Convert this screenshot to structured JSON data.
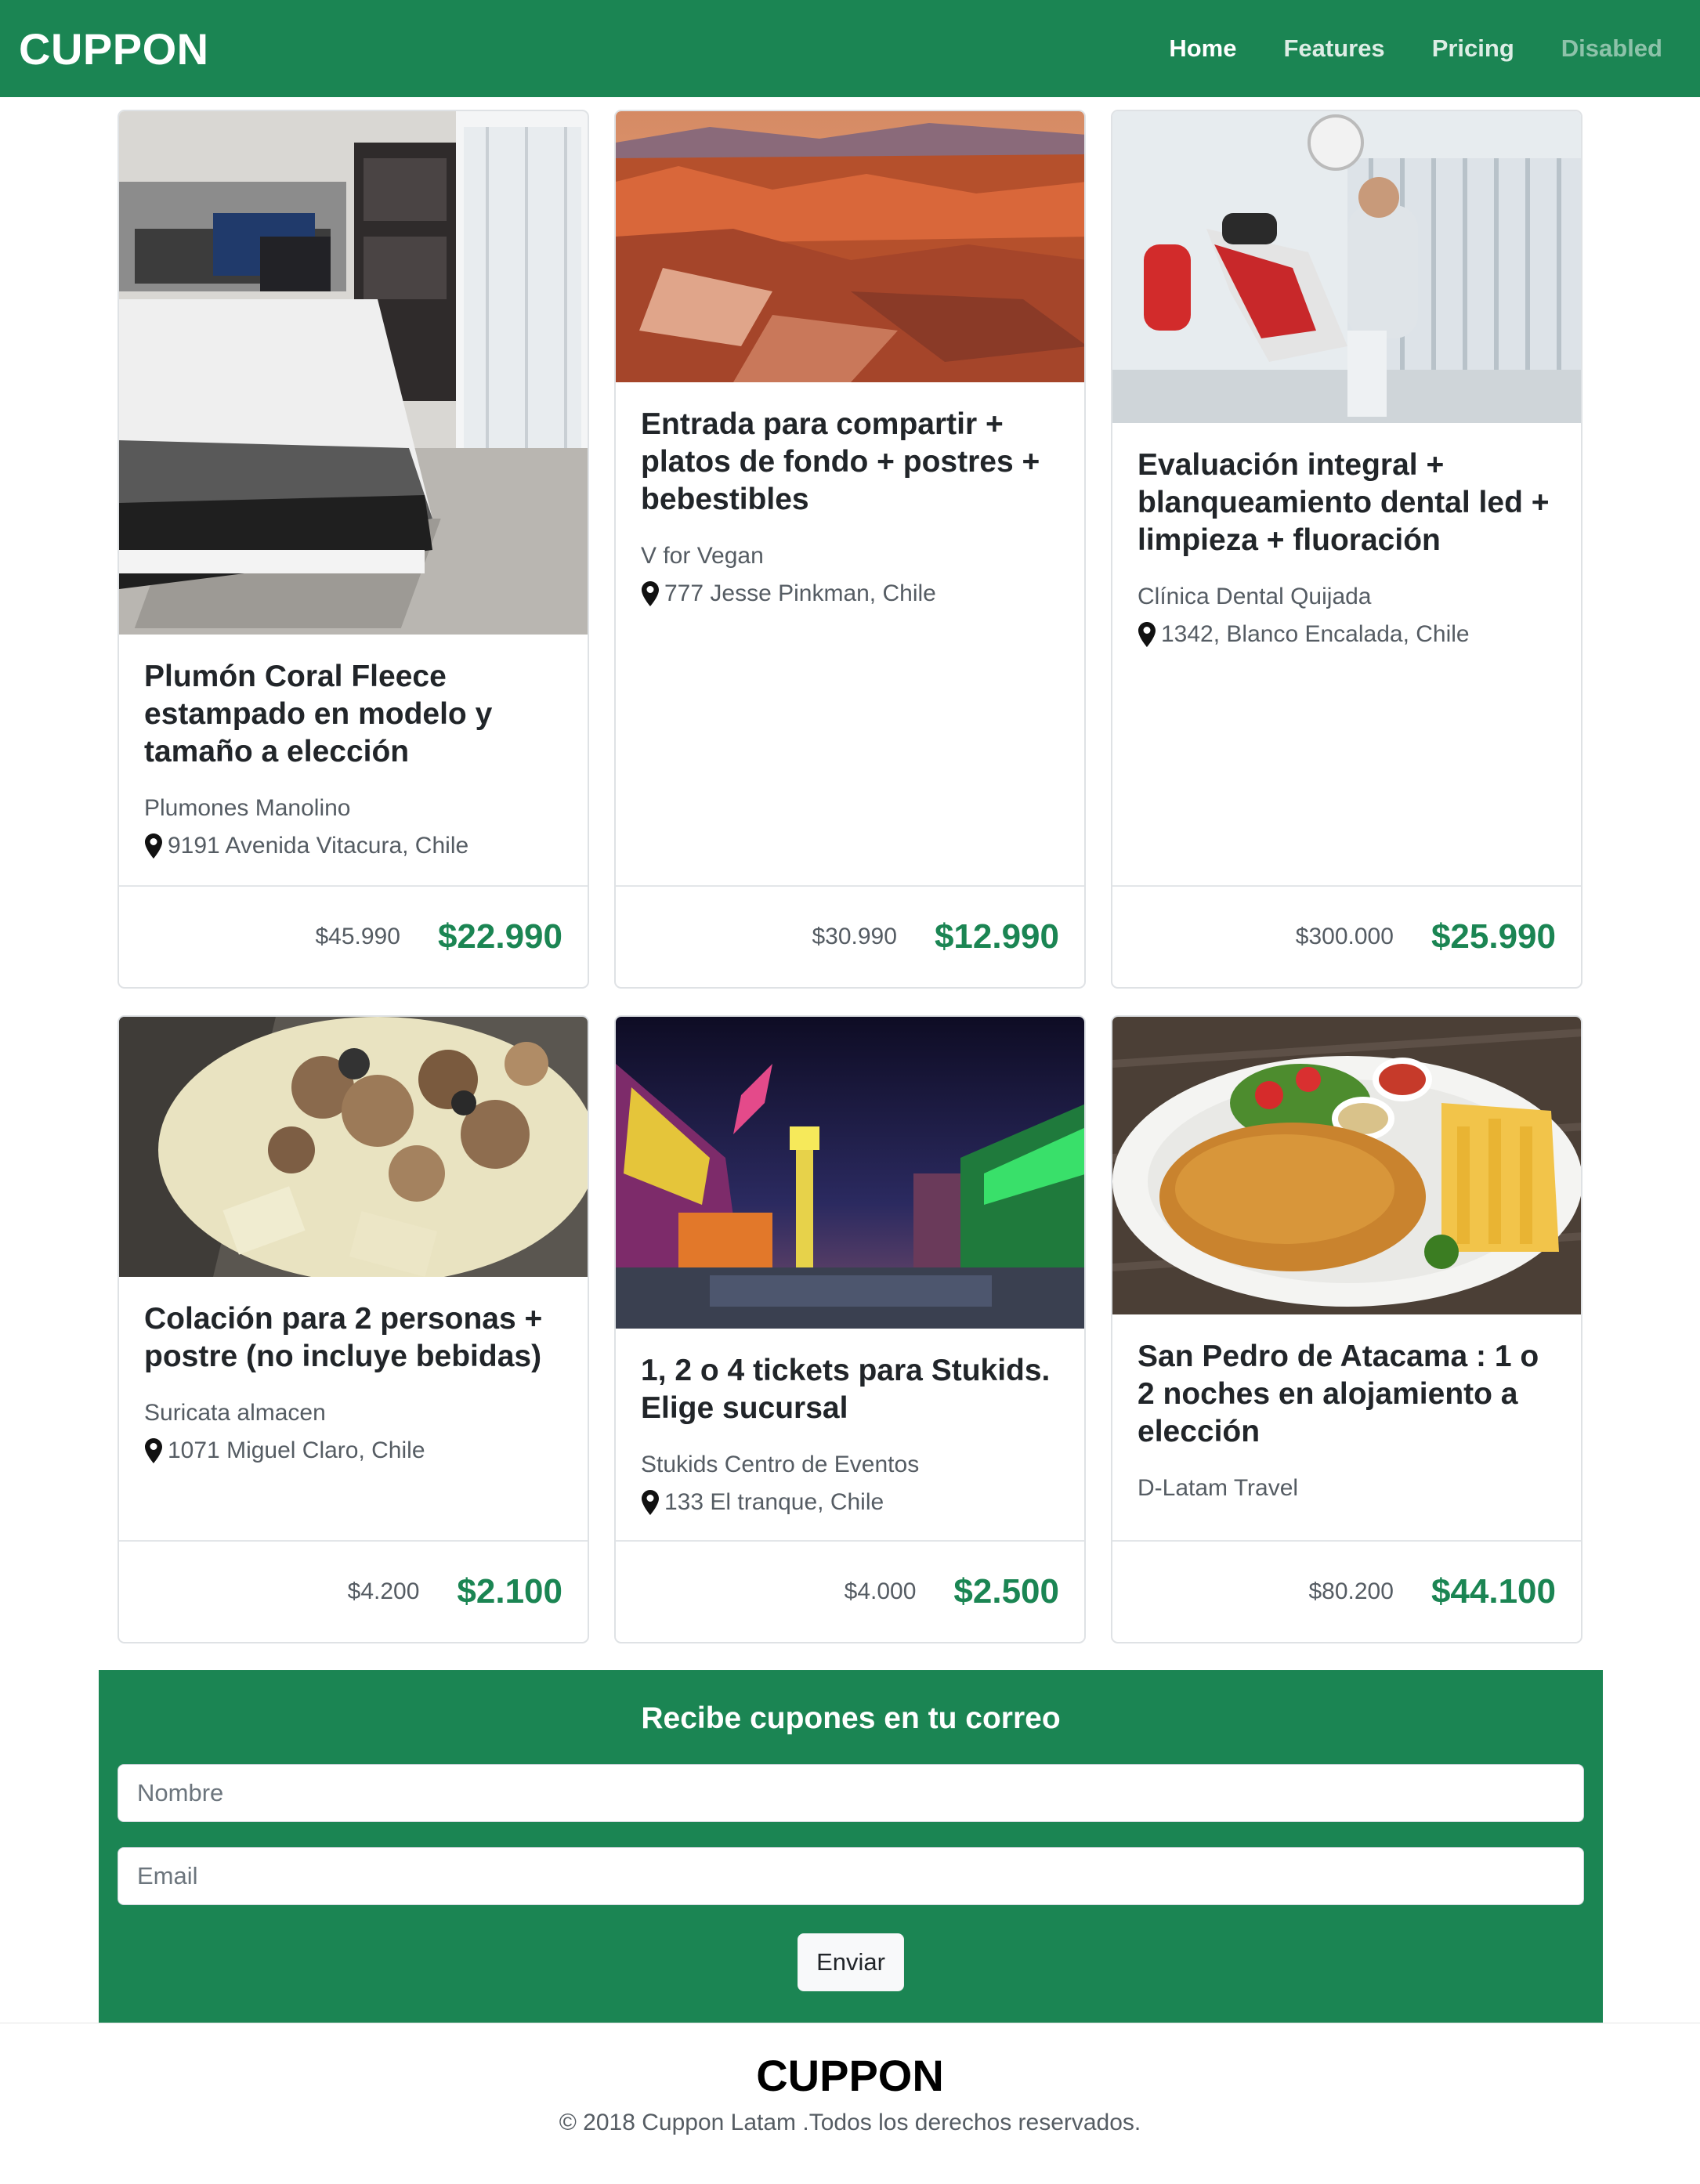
{
  "navbar": {
    "brand": "CUPPON",
    "links": [
      {
        "label": "Home",
        "state": "active"
      },
      {
        "label": "Features",
        "state": "normal"
      },
      {
        "label": "Pricing",
        "state": "normal"
      },
      {
        "label": "Disabled",
        "state": "disabled"
      }
    ]
  },
  "colors": {
    "brand_green": "#1b8553",
    "card_border": "#dfe2e5"
  },
  "deals": [
    {
      "title": "Plumón Coral Fleece estampado en modelo y tamaño a elección",
      "vendor": "Plumones Manolino",
      "address": "9191 Avenida Vitacura, Chile",
      "old_price": "$45.990",
      "new_price": "$22.990",
      "image": "bedroom-duvet-photo"
    },
    {
      "title": "Entrada para compartir + platos de fondo + postres + bebestibles",
      "vendor": "V for Vegan",
      "address": "777 Jesse Pinkman, Chile",
      "old_price": "$30.990",
      "new_price": "$12.990",
      "image": "desert-canyon-photo"
    },
    {
      "title": "Evaluación integral + blanqueamiento dental led + limpieza + fluoración",
      "vendor": "Clínica Dental Quijada",
      "address": "1342, Blanco Encalada, Chile",
      "old_price": "$300.000",
      "new_price": "$25.990",
      "image": "dental-clinic-photo"
    },
    {
      "title": "Colación para 2 personas + postre (no incluye bebidas)",
      "vendor": "Suricata almacen",
      "address": "1071 Miguel Claro, Chile",
      "old_price": "$4.200",
      "new_price": "$2.100",
      "image": "granola-fruit-photo"
    },
    {
      "title": "1, 2 o 4 tickets para Stukids. Elige sucursal",
      "vendor": "Stukids Centro de Eventos",
      "address": "133 El tranque, Chile",
      "old_price": "$4.000",
      "new_price": "$2.500",
      "image": "amusement-park-photo"
    },
    {
      "title": "San Pedro de Atacama : 1 o 2 noches en alojamiento a elección",
      "vendor": "D-Latam Travel",
      "address": "",
      "old_price": "$80.200",
      "new_price": "$44.100",
      "image": "schnitzel-fries-photo"
    }
  ],
  "newsletter": {
    "title": "Recibe cupones en tu correo",
    "name_placeholder": "Nombre",
    "email_placeholder": "Email",
    "submit_label": "Enviar"
  },
  "footer": {
    "brand": "CUPPON",
    "copyright": "© 2018 Cuppon Latam .Todos los derechos reservados."
  }
}
